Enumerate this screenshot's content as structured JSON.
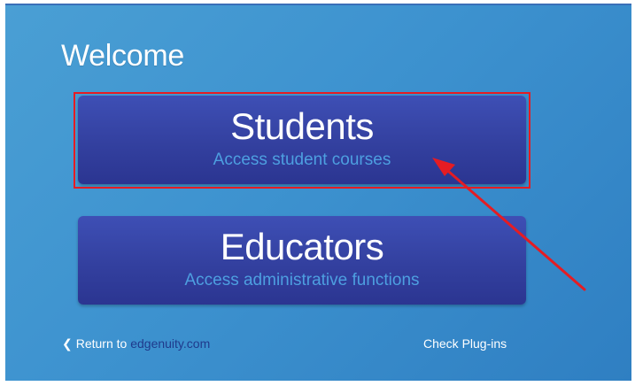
{
  "welcome_title": "Welcome",
  "students": {
    "title": "Students",
    "subtitle": "Access student courses"
  },
  "educators": {
    "title": "Educators",
    "subtitle": "Access administrative functions"
  },
  "footer": {
    "return_prefix": "Return to",
    "return_domain": "edgenuity.com",
    "check_plugins": "Check Plug-ins"
  },
  "colors": {
    "panel_background": "#3d92cf",
    "button_background": "#33409f",
    "subtitle_text": "#4d9fe0",
    "annotation_red": "#e51c23",
    "domain_link": "#1f3a8c"
  },
  "icons": {
    "return_chevron": "chevron-left-icon"
  }
}
